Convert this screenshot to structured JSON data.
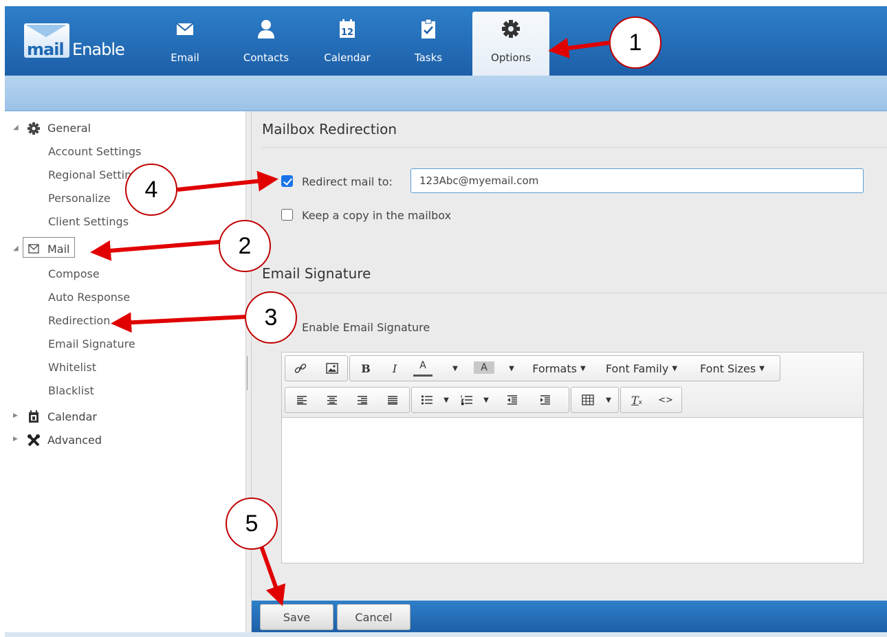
{
  "app": {
    "logo_mail": "mail",
    "logo_enable": "Enable"
  },
  "nav": {
    "tabs": [
      {
        "label": "Email",
        "icon": "envelope-icon"
      },
      {
        "label": "Contacts",
        "icon": "person-icon"
      },
      {
        "label": "Calendar",
        "icon": "calendar-icon",
        "day": "12"
      },
      {
        "label": "Tasks",
        "icon": "clipboard-check-icon"
      },
      {
        "label": "Options",
        "icon": "gear-icon",
        "active": true
      }
    ]
  },
  "sidebar": {
    "general": {
      "label": "General",
      "children": [
        "Account Settings",
        "Regional Settings",
        "Personalize",
        "Client Settings"
      ]
    },
    "mail": {
      "label": "Mail",
      "children": [
        "Compose",
        "Auto Response",
        "Redirection",
        "Email Signature",
        "Whitelist",
        "Blacklist"
      ]
    },
    "calendar": {
      "label": "Calendar"
    },
    "advanced": {
      "label": "Advanced"
    }
  },
  "redirection": {
    "title": "Mailbox Redirection",
    "redirect_label": "Redirect mail to:",
    "redirect_checked": true,
    "redirect_value": "123Abc@myemail.com",
    "keep_copy_label": "Keep a copy in the mailbox",
    "keep_copy_checked": false
  },
  "signature": {
    "title": "Email Signature",
    "enable_label": "Enable Email Signature",
    "toolbar": {
      "bold": "B",
      "italic": "I",
      "font_color": "A",
      "bg_color": "A",
      "formats": "Formats",
      "font_family": "Font Family",
      "font_sizes": "Font Sizes",
      "clear_format": "T",
      "source_code": "<>"
    }
  },
  "actions": {
    "save": "Save",
    "cancel": "Cancel"
  },
  "annotations": {
    "step1": "1",
    "step2": "2",
    "step3": "3",
    "step4": "4",
    "step5": "5",
    "color": "#e00000"
  },
  "colors": {
    "topbar": "#1d5fa8",
    "checkbox": "#1a73e8",
    "annotation": "#e00000"
  }
}
